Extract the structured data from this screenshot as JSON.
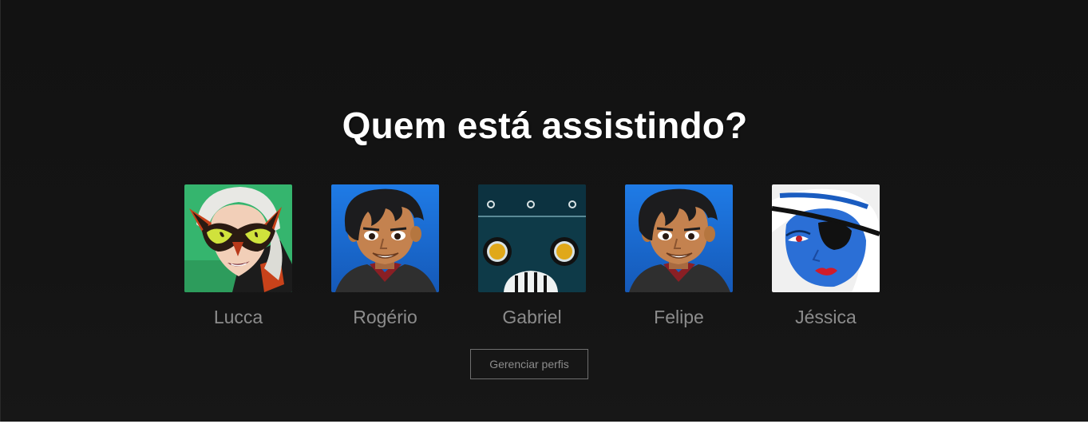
{
  "page": {
    "title": "Quem está assistindo?"
  },
  "profiles": [
    {
      "name": "Lucca",
      "avatar_icon": "cat-mask-woman-avatar-icon",
      "bg": "#35b56e"
    },
    {
      "name": "Rogério",
      "avatar_icon": "dark-haired-boy-avatar-icon",
      "bg": "#1a6fd6"
    },
    {
      "name": "Gabriel",
      "avatar_icon": "robot-avatar-icon",
      "bg": "#0e3a48"
    },
    {
      "name": "Felipe",
      "avatar_icon": "dark-haired-boy-avatar-icon",
      "bg": "#1a6fd6"
    },
    {
      "name": "Jéssica",
      "avatar_icon": "eyepatch-woman-avatar-icon",
      "bg": "#f0f0f0"
    }
  ],
  "actions": {
    "manage_label": "Gerenciar perfis"
  },
  "colors": {
    "background": "#141414",
    "title": "#ffffff",
    "profile_name": "#8c8c8c",
    "button_border": "#6f6f6f"
  }
}
